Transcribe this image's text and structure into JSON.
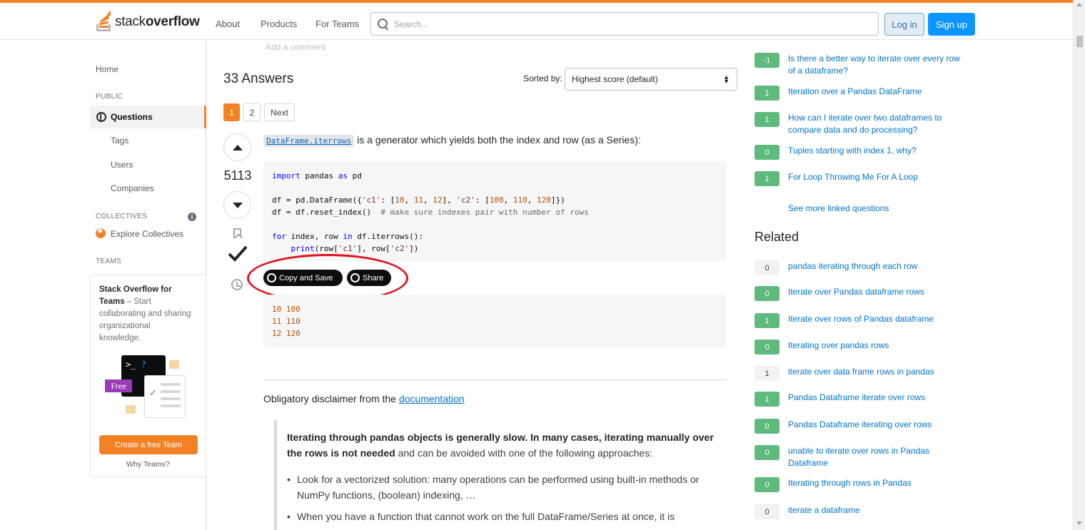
{
  "header": {
    "logo_part1": "stack",
    "logo_part2": "overflow",
    "nav": [
      "About",
      "Products",
      "For Teams"
    ],
    "search_placeholder": "Search...",
    "login_label": "Log in",
    "signup_label": "Sign up",
    "accent_color": "#f48225"
  },
  "sidebar": {
    "home": "Home",
    "public_heading": "PUBLIC",
    "questions": "Questions",
    "tags": "Tags",
    "users": "Users",
    "companies": "Companies",
    "collectives_heading": "COLLECTIVES",
    "explore_collectives": "Explore Collectives",
    "teams_heading": "TEAMS",
    "teams_card": {
      "title": "Stack Overflow for Teams",
      "dash": " – ",
      "body": "Start collaborating and sharing organizational knowledge.",
      "terminal_prompt": ">_",
      "terminal_q": "?",
      "free_badge": "Free",
      "create_button": "Create a free Team",
      "why_link": "Why Teams?"
    }
  },
  "main": {
    "add_comment": "Add a comment",
    "answers_count": "33 Answers",
    "sorted_by_label": "Sorted by:",
    "sort_value": "Highest score (default)",
    "pagination": [
      "1",
      "2",
      "Next"
    ],
    "answer": {
      "score": "5113",
      "intro_code": "DataFrame.iterrows",
      "intro_text": " is a generator which yields both the index and row (as a Series):",
      "code_lines": [
        "import pandas as pd",
        "",
        "df = pd.DataFrame({'c1': [10, 11, 12], 'c2': [100, 110, 120]})",
        "df = df.reset_index()  # make sure indexes pair with number of rows",
        "",
        "for index, row in df.iterrows():",
        "    print(row['c1'], row['c2'])"
      ],
      "copy_button": "Copy and Save",
      "share_button": "Share",
      "output_lines": [
        "10 100",
        "11 110",
        "12 120"
      ],
      "disclaimer_prefix": "Obligatory disclaimer from the ",
      "disclaimer_link": "documentation",
      "quote_bold": "Iterating through pandas objects is generally slow. In many cases, iterating manually over the rows is not needed",
      "quote_rest": " and can be avoided with one of the following approaches:",
      "bullets": [
        "Look for a vectorized solution: many operations can be performed using built-in methods or NumPy functions, (boolean) indexing, …",
        "When you have a function that cannot work on the full DataFrame/Series at once, it is"
      ]
    }
  },
  "right": {
    "linked": [
      {
        "score": "-1",
        "title": "Is there a better way to iterate over every row of a dataframe?",
        "answered": true
      },
      {
        "score": "1",
        "title": "Iteration over a Pandas DataFrame",
        "answered": true
      },
      {
        "score": "1",
        "title": "How can I iterate over two dataframes to compare data and do processing?",
        "answered": true
      },
      {
        "score": "0",
        "title": "Tuples starting with index 1, why?",
        "answered": true
      },
      {
        "score": "1",
        "title": "For Loop Throwing Me For A Loop",
        "answered": true
      }
    ],
    "see_more": "See more linked questions",
    "related_heading": "Related",
    "related": [
      {
        "score": "0",
        "title": "pandas iterating through each row",
        "answered": false
      },
      {
        "score": "0",
        "title": "Iterate over Pandas dataframe rows",
        "answered": true
      },
      {
        "score": "1",
        "title": "Iterate over rows of Pandas dataframe",
        "answered": true
      },
      {
        "score": "0",
        "title": "Iterating over pandas rows",
        "answered": true
      },
      {
        "score": "1",
        "title": "iterate over data frame rows in pandas",
        "answered": false
      },
      {
        "score": "1",
        "title": "Pandas Dataframe iterate over rows",
        "answered": true
      },
      {
        "score": "0",
        "title": "Pandas Dataframe iterating over rows",
        "answered": true
      },
      {
        "score": "0",
        "title": "unable to iterate over rows in Pandas Dataframe",
        "answered": true
      },
      {
        "score": "0",
        "title": "Iterating through rows in Pandas",
        "answered": true
      },
      {
        "score": "0",
        "title": "iterate a dataframe",
        "answered": false
      }
    ]
  }
}
